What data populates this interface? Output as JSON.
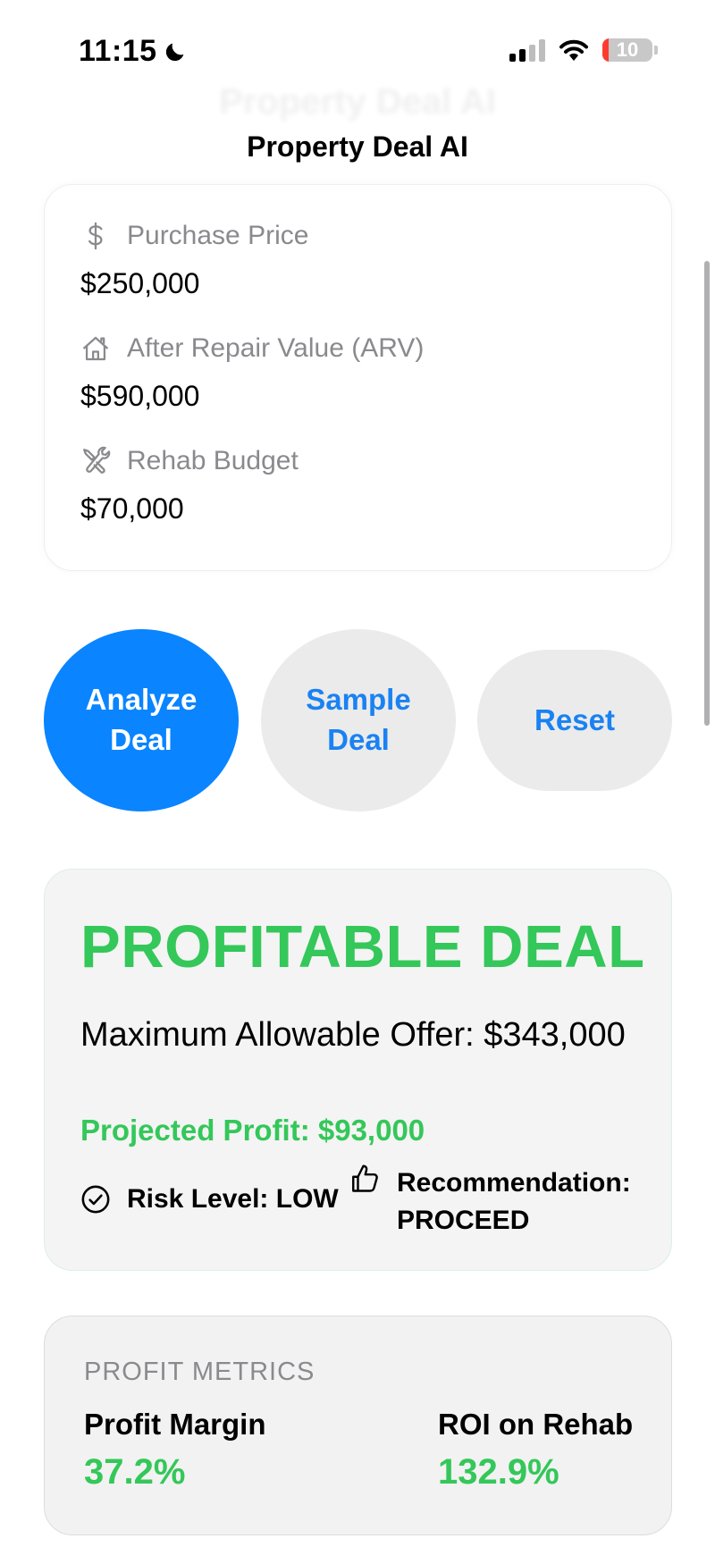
{
  "status_bar": {
    "time": "11:15",
    "battery_level": "10"
  },
  "header": {
    "ghost_title": "Property Deal AI",
    "title": "Property Deal AI"
  },
  "inputs": {
    "purchase_price": {
      "label": "Purchase Price",
      "value": "$250,000",
      "icon": "dollar-icon"
    },
    "arv": {
      "label": "After Repair Value (ARV)",
      "value": "$590,000",
      "icon": "house-icon"
    },
    "rehab": {
      "label": "Rehab Budget",
      "value": "$70,000",
      "icon": "tools-icon"
    }
  },
  "actions": {
    "analyze": "Analyze Deal",
    "sample": "Sample Deal",
    "reset": "Reset"
  },
  "result": {
    "verdict": "PROFITABLE DEAL",
    "mao": "Maximum Allowable Offer: $343,000",
    "projected_profit": "Projected Profit: $93,000",
    "risk": "Risk Level: LOW",
    "recommendation": "Recommendation: PROCEED"
  },
  "metrics": {
    "heading": "PROFIT METRICS",
    "profit_margin": {
      "label": "Profit Margin",
      "value": "37.2%"
    },
    "roi_rehab": {
      "label": "ROI on Rehab",
      "value": "132.9%"
    }
  },
  "colors": {
    "accent": "#0a84ff",
    "success": "#34c759",
    "secondary_button": "#ebebeb"
  }
}
